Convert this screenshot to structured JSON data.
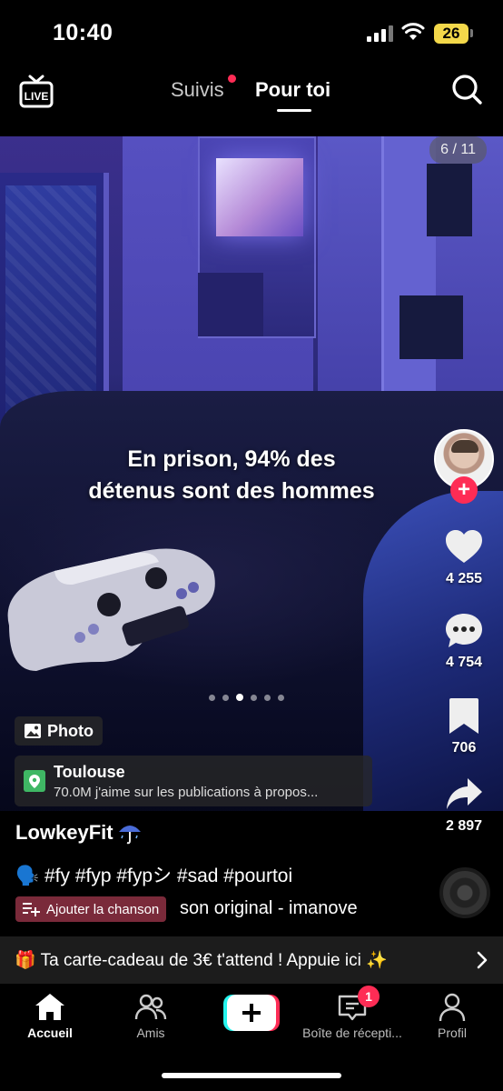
{
  "status_bar": {
    "time": "10:40",
    "battery": "26"
  },
  "top_nav": {
    "live_label": "LIVE",
    "tabs": [
      {
        "label": "Suivis",
        "has_dot": true
      },
      {
        "label": "Pour toi",
        "active": true
      }
    ]
  },
  "media": {
    "photo_counter": "6 / 11",
    "overlay_text": [
      "En prison, 94% des",
      "détenus sont des hommes"
    ],
    "carousel_dots": 6,
    "active_dot": 3
  },
  "rail": {
    "likes": "4 255",
    "comments": "4 754",
    "saves": "706",
    "shares": "2 897"
  },
  "post": {
    "type_badge": "Photo",
    "location": {
      "title": "Toulouse",
      "subtitle": "70.0M j'aime sur les publications à propos..."
    },
    "username": "LowkeyFit",
    "caption": "🗣️ #fy #fyp #fypシ #sad #pourtoi",
    "add_song_label": "Ajouter la chanson",
    "sound": "son original - imanove"
  },
  "promo": {
    "text": "🎁 Ta carte-cadeau de 3€ t'attend ! Appuie ici ✨"
  },
  "bottom_nav": {
    "items": [
      {
        "label": "Accueil",
        "active": true
      },
      {
        "label": "Amis"
      },
      {
        "label": ""
      },
      {
        "label": "Boîte de récepti...",
        "badge": "1"
      },
      {
        "label": "Profil"
      }
    ]
  },
  "colors": {
    "accent": "#fe2c55",
    "battery": "#f3d84a",
    "background": "#000000"
  }
}
